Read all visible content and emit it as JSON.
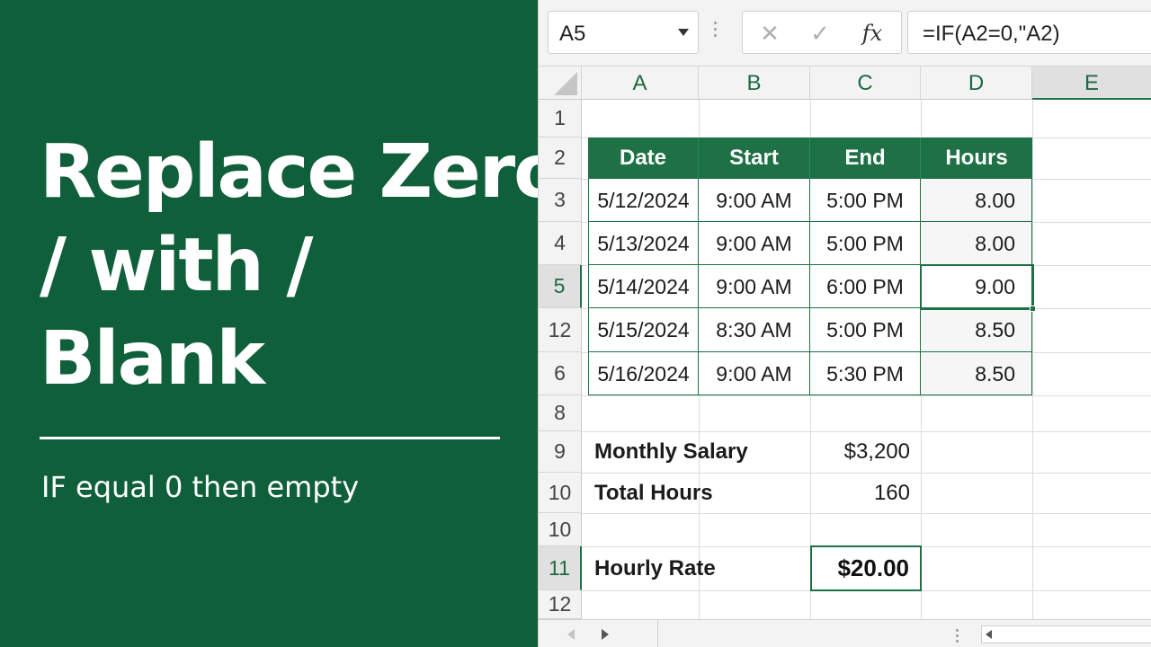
{
  "banner": {
    "title_lines": [
      "Replace Zero",
      "/ with /",
      "Blank"
    ],
    "subtitle": "IF equal 0 then empty",
    "background": "#0f5f3a"
  },
  "formula_bar": {
    "name_box": "A5",
    "cancel_icon": "✕",
    "enter_icon": "✓",
    "fx_label": "fx",
    "formula": "=IF(A2=0,\"A2)"
  },
  "columns": [
    "A",
    "B",
    "C",
    "D",
    "E"
  ],
  "rows": [
    "1",
    "2",
    "3",
    "4",
    "5",
    "12",
    "6",
    "8",
    "9",
    "10",
    "10",
    "11",
    "12"
  ],
  "table": {
    "headers": [
      "Date",
      "Start",
      "End",
      "Hours"
    ],
    "rows": [
      [
        "5/12/2024",
        "9:00 AM",
        "5:00 PM",
        "8.00"
      ],
      [
        "5/13/2024",
        "9:00 AM",
        "5:00 PM",
        "8.00"
      ],
      [
        "5/14/2024",
        "9:00 AM",
        "6:00 PM",
        "9.00"
      ],
      [
        "5/15/2024",
        "8:30 AM",
        "5:00 PM",
        "8.50"
      ],
      [
        "5/16/2024",
        "9:00 AM",
        "5:30 PM",
        "8.50"
      ]
    ]
  },
  "summary": {
    "salary_label": "Monthly Salary",
    "salary_value": "$3,200",
    "hours_label": "Total Hours",
    "hours_value": "160",
    "rate_label": "Hourly Rate",
    "rate_value": "$20.00"
  },
  "accent_color": "#1e7145"
}
